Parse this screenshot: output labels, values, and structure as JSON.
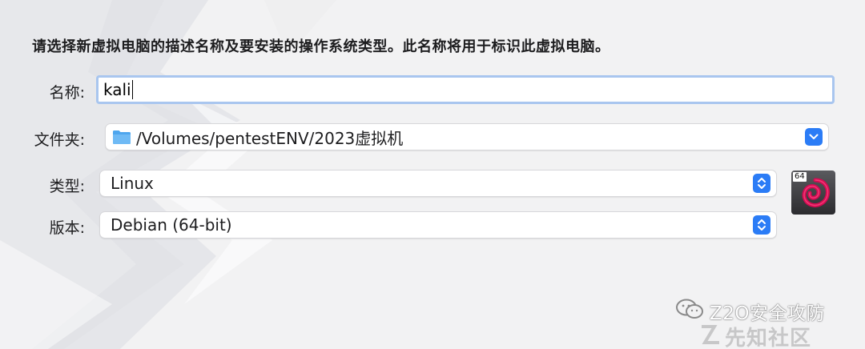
{
  "dialog": {
    "intro_text": "请选择新虚拟电脑的描述名称及要安装的操作系统类型。此名称将用于标识此虚拟电脑。"
  },
  "fields": {
    "name": {
      "label": "名称:",
      "value": "kali"
    },
    "folder": {
      "label": "文件夹:",
      "value": "/Volumes/pentestENV/2023虚拟机",
      "icon": "folder-icon"
    },
    "type": {
      "label": "类型:",
      "value": "Linux"
    },
    "version": {
      "label": "版本:",
      "value": "Debian (64-bit)"
    }
  },
  "os_icon": {
    "name": "debian-icon",
    "badge": "64"
  },
  "watermarks": {
    "wechat": "Z2O安全攻防",
    "site": "先知社区"
  },
  "colors": {
    "accent": "#2b7cf6",
    "focus_ring": "#a9c6ef",
    "debian_red": "#d70a53",
    "background": "#f2f2f3"
  }
}
